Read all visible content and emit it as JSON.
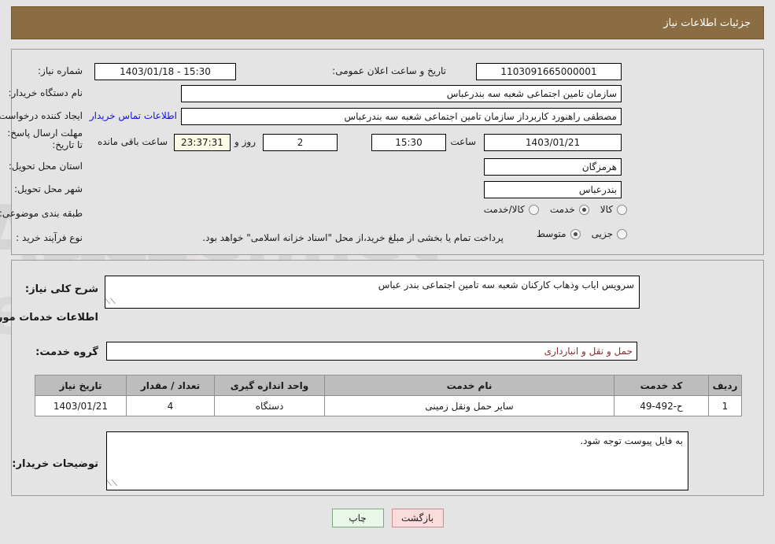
{
  "header": {
    "title": "جزئیات اطلاعات نیاز",
    "bar_color": "#8a6d42"
  },
  "need_info": {
    "need_number_label": "شماره نیاز:",
    "need_number_value": "1103091665000001",
    "announce_label": "تاریخ و ساعت اعلان عمومی:",
    "announce_value": "15:30 - 1403/01/18",
    "buyer_org_label": "نام دستگاه خریدار:",
    "buyer_org_value": "سازمان تامین اجتماعی شعبه سه بندرعباس",
    "requester_label": "ایجاد کننده درخواست:",
    "requester_value": "مصطفی راهنورد کاربرداز سازمان تامین اجتماعی شعبه سه بندرعباس",
    "contact_link": "اطلاعات تماس خریدار",
    "deadline_label": "مهلت ارسال پاسخ: تا تاریخ:",
    "deadline_date": "1403/01/21",
    "hour_label": "ساعت",
    "deadline_time": "15:30",
    "days_remaining": "2",
    "days_label": "روز و",
    "time_remaining": "23:37:31",
    "time_remaining_label": "ساعت باقی مانده",
    "province_label": "استان محل تحویل:",
    "province_value": "هرمزگان",
    "city_label": "شهر محل تحویل:",
    "city_value": "بندرعباس",
    "category_label": "طبقه بندی موضوعی:",
    "category_options": [
      {
        "label": "کالا",
        "selected": false
      },
      {
        "label": "خدمت",
        "selected": true
      },
      {
        "label": "کالا/خدمت",
        "selected": false
      }
    ],
    "process_label": "نوع فرآیند خرید :",
    "process_options": [
      {
        "label": "جزیی",
        "selected": false
      },
      {
        "label": "متوسط",
        "selected": true
      }
    ],
    "payment_note": "پرداخت تمام یا بخشی از مبلغ خرید،از محل \"اسناد خزانه اسلامی\" خواهد بود."
  },
  "need_desc": {
    "label": "شرح کلی نیاز:",
    "value": "سرویس ایاب وذهاب کارکنان شعبه سه تامین اجتماعی بندر عباس"
  },
  "services": {
    "section_title": "اطلاعات خدمات مورد نیاز",
    "group_label": "گروه خدمت:",
    "group_value": "حمل و نقل و انبارداری",
    "columns": [
      "ردیف",
      "کد خدمت",
      "نام خدمت",
      "واحد اندازه گیری",
      "تعداد / مقدار",
      "تاریخ نیاز"
    ],
    "rows": [
      {
        "row": "1",
        "code": "ح-492-49",
        "name": "سایر حمل ونقل زمینی",
        "unit": "دستگاه",
        "qty": "4",
        "need_date": "1403/01/21"
      }
    ]
  },
  "buyer_notes": {
    "label": "توضیحات خریدار:",
    "value": "به فایل پیوست توجه شود."
  },
  "footer": {
    "print_label": "چاپ",
    "back_label": "بازگشت"
  },
  "watermark": {
    "text": "AriaTender.net"
  }
}
